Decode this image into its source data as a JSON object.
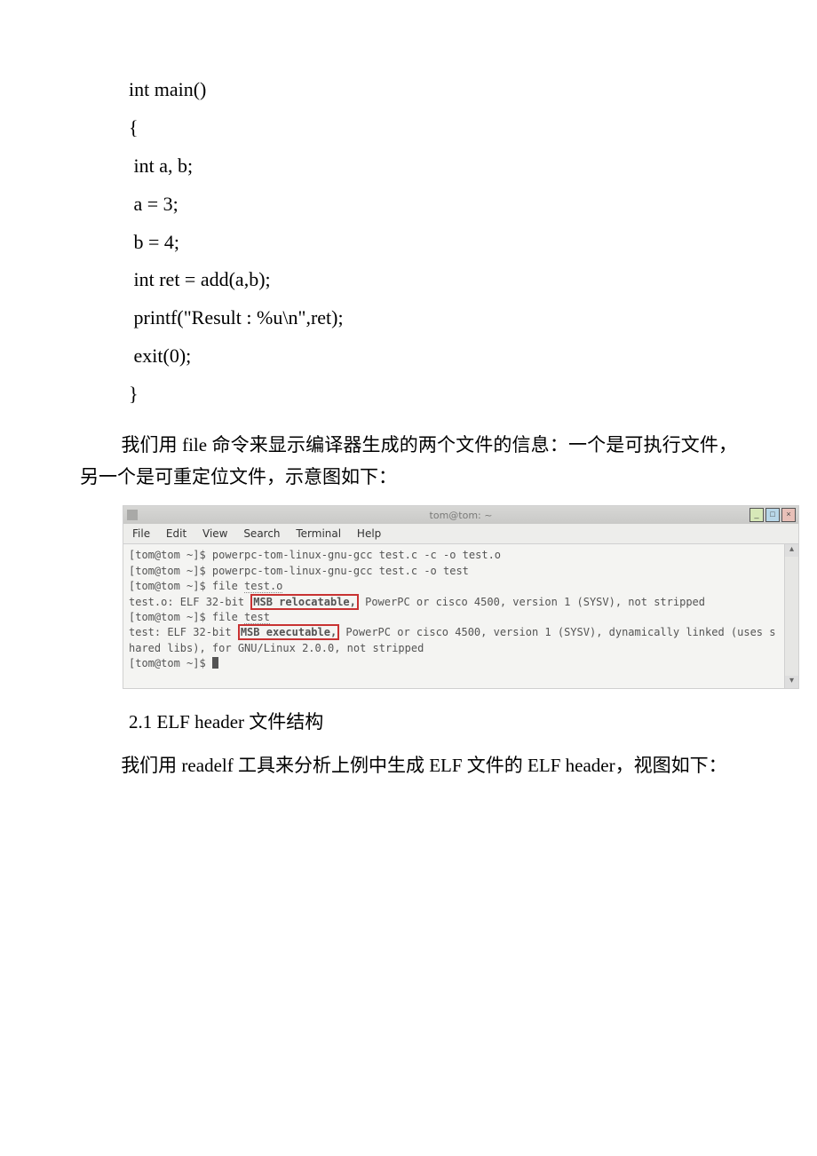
{
  "code": {
    "l1": "int main()",
    "l2": "{",
    "l3": " int a, b;",
    "l4": " a = 3;",
    "l5": " b = 4;",
    "l6": " int ret = add(a,b);",
    "l7": " printf(\"Result : %u\\n\",ret);",
    "l8": " exit(0);",
    "l9": "}"
  },
  "para1_pre": "我们用 file 命令来显示编译器生成的两个文件的信息：一个是可执行文件，另一个是可重定位文件，示意图如下：",
  "terminal": {
    "title": "tom@tom: ~",
    "menu": {
      "file": "File",
      "edit": "Edit",
      "view": "View",
      "search": "Search",
      "terminal": "Terminal",
      "help": "Help"
    },
    "l1": "[tom@tom ~]$ powerpc-tom-linux-gnu-gcc test.c -c -o test.o",
    "l2": "[tom@tom ~]$ powerpc-tom-linux-gnu-gcc test.c -o test",
    "l3a": "[tom@tom ~]$ file ",
    "l3b": "test.o",
    "l4a": "test.o: ELF 32-bit ",
    "l4b": "MSB relocatable,",
    "l4c": " PowerPC or cisco 4500, version 1 (SYSV), not stripped",
    "l5a": "[tom@tom ~]$ file ",
    "l5b": "test",
    "l6a": "test: ELF 32-bit ",
    "l6b": "MSB executable,",
    "l6c": " PowerPC or cisco 4500, version 1 (SYSV), dynamically linked (uses shared libs), for GNU/Linux 2.0.0, not stripped",
    "l7": "[tom@tom ~]$ ",
    "scroll_up": "▴",
    "scroll_down": "▾",
    "btn_min": "_",
    "btn_max": "□",
    "btn_cls": "×"
  },
  "section_heading": "2.1 ELF header 文件结构",
  "para2": "我们用 readelf 工具来分析上例中生成 ELF 文件的 ELF header，视图如下："
}
